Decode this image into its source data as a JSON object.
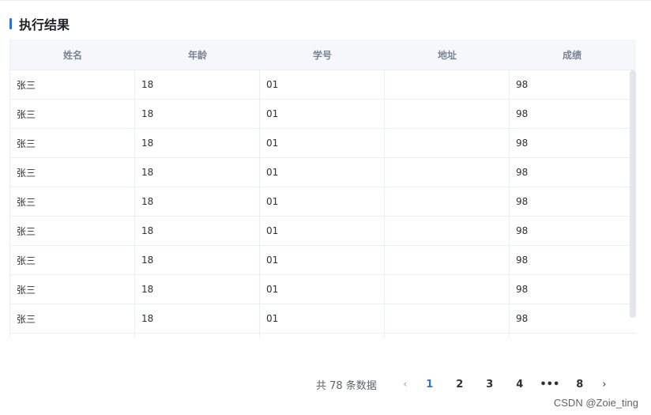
{
  "section": {
    "title": "执行结果"
  },
  "table": {
    "columns": [
      "姓名",
      "年龄",
      "学号",
      "地址",
      "成绩"
    ],
    "rows": [
      [
        "张三",
        "18",
        "01",
        "",
        "98"
      ],
      [
        "张三",
        "18",
        "01",
        "",
        "98"
      ],
      [
        "张三",
        "18",
        "01",
        "",
        "98"
      ],
      [
        "张三",
        "18",
        "01",
        "",
        "98"
      ],
      [
        "张三",
        "18",
        "01",
        "",
        "98"
      ],
      [
        "张三",
        "18",
        "01",
        "",
        "98"
      ],
      [
        "张三",
        "18",
        "01",
        "",
        "98"
      ],
      [
        "张三",
        "18",
        "01",
        "",
        "98"
      ],
      [
        "张三",
        "18",
        "01",
        "",
        "98"
      ],
      [
        "",
        "",
        "",
        "",
        ""
      ]
    ]
  },
  "pagination": {
    "total_text": "共 78 条数据",
    "prev_icon": "‹",
    "pages": [
      "1",
      "2",
      "3",
      "4"
    ],
    "more": "•••",
    "last_page": "8",
    "next_icon": "›",
    "active_page": "1"
  },
  "watermark": "CSDN @Zoie_ting",
  "colors": {
    "accent": "#2f6fe4",
    "header_bg": "#f5f7fa",
    "border": "#ebeef5"
  }
}
